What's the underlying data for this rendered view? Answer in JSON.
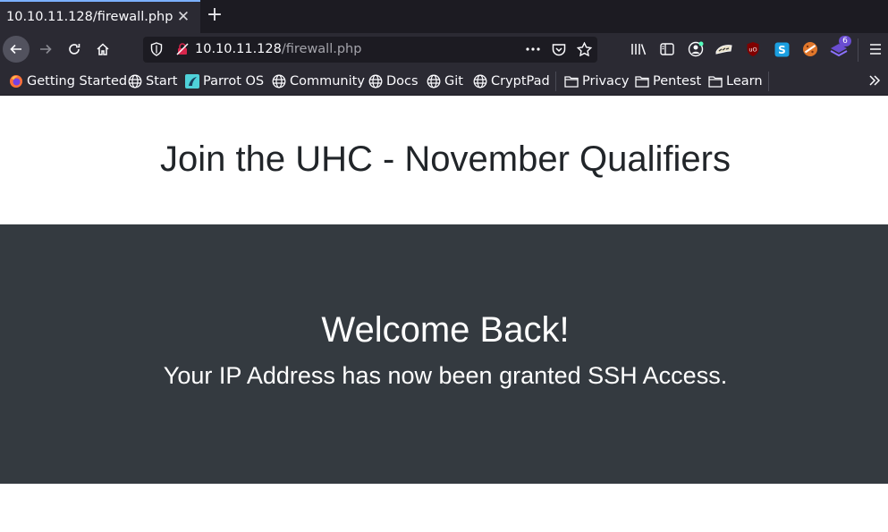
{
  "tab": {
    "title": "10.10.11.128/firewall.php",
    "close_icon": "close-icon",
    "new_tab_icon": "plus-icon"
  },
  "urlbar": {
    "host": "10.10.11.128",
    "path": "/firewall.php",
    "shield_icon": "tracking-shield-icon",
    "insecure_icon": "insecure-lock-icon",
    "menu_icon": "ellipsis-icon",
    "pocket_icon": "pocket-icon",
    "bookmark_icon": "star-icon"
  },
  "toolbar": {
    "extension_badge": "6",
    "icons": [
      "library-icon",
      "sidebar-icon",
      "account-icon",
      "hackbar-icon",
      "ublock-icon",
      "s-extension-icon",
      "cookie-icon",
      "foxyproxy-icon",
      "hamburger-menu-icon"
    ]
  },
  "bookmarks": {
    "items": [
      {
        "label": "Getting Started",
        "icon": "firefox-icon"
      },
      {
        "label": "Start",
        "icon": "globe-icon"
      },
      {
        "label": "Parrot OS",
        "icon": "parrot-icon"
      },
      {
        "label": "Community",
        "icon": "globe-icon"
      },
      {
        "label": "Docs",
        "icon": "globe-icon"
      },
      {
        "label": "Git",
        "icon": "globe-icon"
      },
      {
        "label": "CryptPad",
        "icon": "globe-icon"
      }
    ],
    "folders": [
      {
        "label": "Privacy",
        "icon": "folder-icon"
      },
      {
        "label": "Pentest",
        "icon": "folder-icon"
      },
      {
        "label": "Learn",
        "icon": "folder-icon"
      }
    ]
  },
  "page": {
    "heading": "Join the UHC - November Qualifiers",
    "jumbotron_title": "Welcome Back!",
    "jumbotron_text": "Your IP Address has now been granted SSH Access."
  },
  "colors": {
    "jumbotron_bg": "#343a40",
    "heading_text": "#212529",
    "chrome_bg": "#2b2a33",
    "urlbar_bg": "#1c1b22"
  }
}
